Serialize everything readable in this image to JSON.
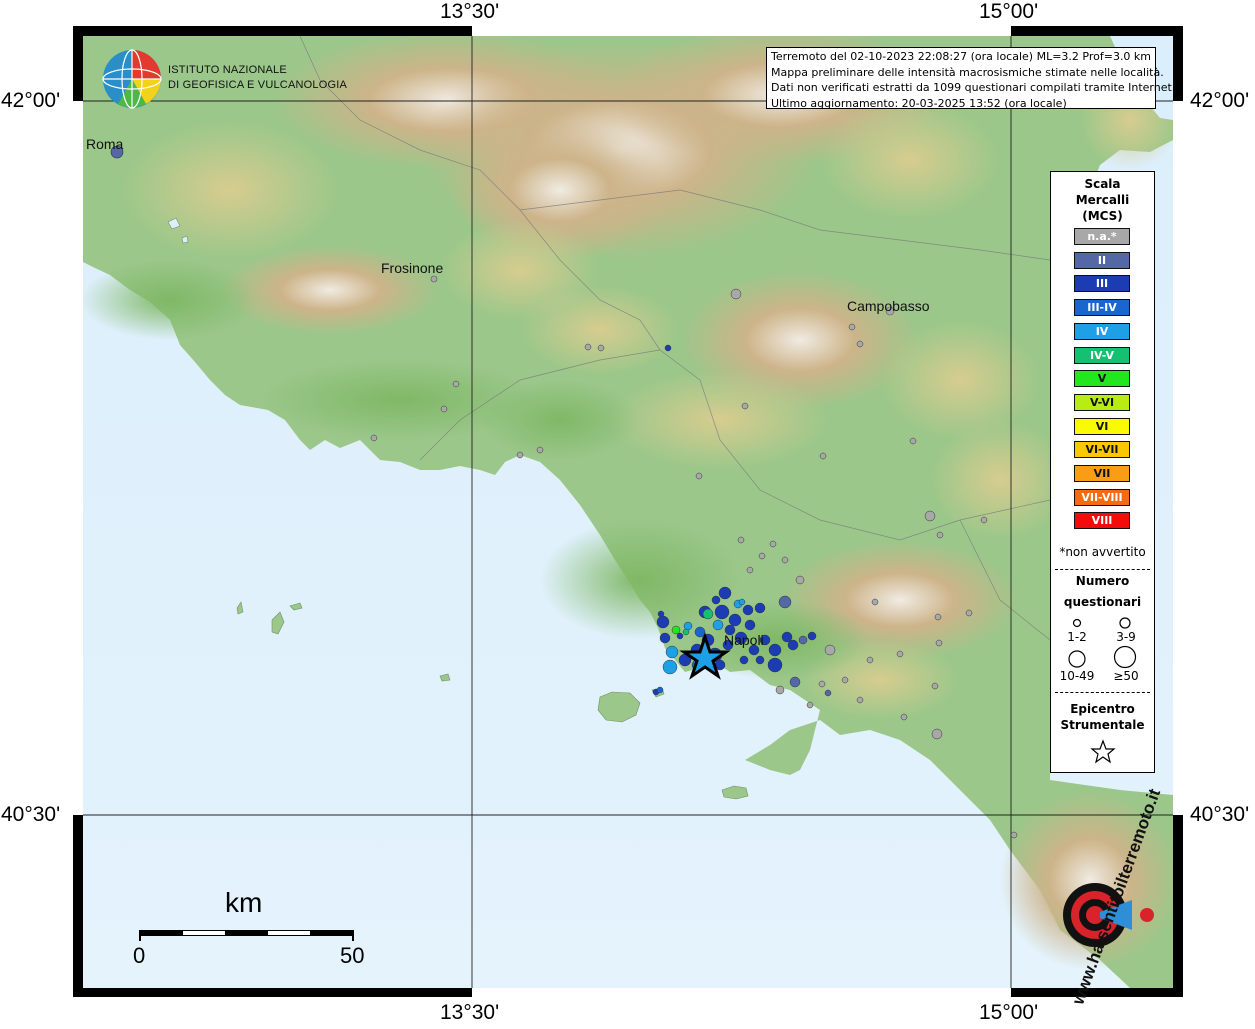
{
  "frame": {
    "lon_labels": [
      "13°30'",
      "15°00'"
    ],
    "lat_labels": [
      "42°00'",
      "40°30'"
    ]
  },
  "logo": {
    "line1": "ISTITUTO NAZIONALE",
    "line2": "DI GEOFISICA E VULCANOLOGIA"
  },
  "info": {
    "line1": "Terremoto del 02-10-2023 22:08:27 (ora locale) ML=3.2 Prof=3.0 km",
    "line2": "Mappa preliminare delle intensità macrosismiche stimate nelle località.",
    "line3": "Dati non verificati estratti da 1099 questionari compilati tramite Internet.",
    "line4": "Ultimo aggiornamento: 20-03-2025 13:52 (ora locale)"
  },
  "cities": [
    {
      "name": "Roma"
    },
    {
      "name": "Frosinone"
    },
    {
      "name": "Campobasso"
    },
    {
      "name": "Napoli"
    }
  ],
  "legend": {
    "title1": "Scala",
    "title2": "Mercalli",
    "title3": "(MCS)",
    "classes": [
      {
        "label": "n.a.*",
        "color": "#a8a8a8"
      },
      {
        "label": "II",
        "color": "#5468a8"
      },
      {
        "label": "III",
        "color": "#1c3cb4"
      },
      {
        "label": "III-IV",
        "color": "#1a66d0"
      },
      {
        "label": "IV",
        "color": "#1ea0e6"
      },
      {
        "label": "IV-V",
        "color": "#16c072"
      },
      {
        "label": "V",
        "color": "#22e61e"
      },
      {
        "label": "V-VI",
        "color": "#b8ec12"
      },
      {
        "label": "VI",
        "color": "#fafa00"
      },
      {
        "label": "VI-VII",
        "color": "#fac800"
      },
      {
        "label": "VII",
        "color": "#f89e14"
      },
      {
        "label": "VII-VIII",
        "color": "#f56a12"
      },
      {
        "label": "VIII",
        "color": "#f20c0c"
      }
    ],
    "note": "*non avvertito",
    "count_title1": "Numero",
    "count_title2": "questionari",
    "counts": [
      "1-2",
      "3-9",
      "10-49",
      "≥50"
    ],
    "epi_title1": "Epicentro",
    "epi_title2": "Strumentale"
  },
  "scale_bar": {
    "unit": "km",
    "start": "0",
    "end": "50"
  },
  "watermark": {
    "text": "www.haisentitoilterremoto.it"
  }
}
